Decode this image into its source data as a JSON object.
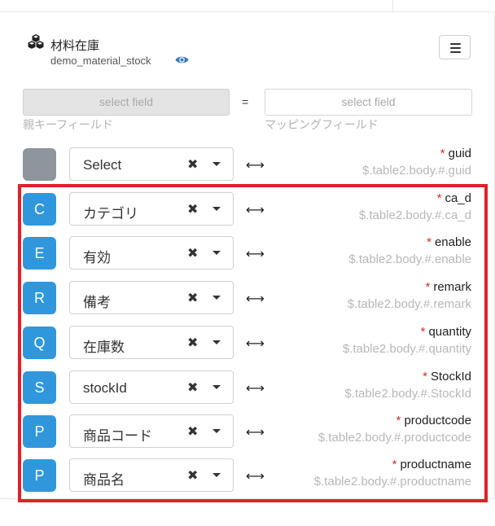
{
  "header": {
    "title": "材料在庫",
    "subtitle": "demo_material_stock"
  },
  "mapping": {
    "left_placeholder": "select field",
    "right_placeholder": "select field",
    "equals": "=",
    "left_label": "親キーフィールド",
    "right_label": "マッピングフィールド",
    "arrow_symbol": "⟷",
    "clear_symbol": "✖",
    "required_mark": "*"
  },
  "rows": [
    {
      "badge": "",
      "badge_color": "#8e959c",
      "value": "Select",
      "name": "guid",
      "path": "$.table2.body.#.guid"
    },
    {
      "badge": "C",
      "badge_color": "#3097dc",
      "value": "カテゴリ",
      "name": "ca_d",
      "path": "$.table2.body.#.ca_d"
    },
    {
      "badge": "E",
      "badge_color": "#3097dc",
      "value": "有効",
      "name": "enable",
      "path": "$.table2.body.#.enable"
    },
    {
      "badge": "R",
      "badge_color": "#3097dc",
      "value": "備考",
      "name": "remark",
      "path": "$.table2.body.#.remark"
    },
    {
      "badge": "Q",
      "badge_color": "#3097dc",
      "value": "在庫数",
      "name": "quantity",
      "path": "$.table2.body.#.quantity"
    },
    {
      "badge": "S",
      "badge_color": "#3097dc",
      "value": "stockId",
      "name": "StockId",
      "path": "$.table2.body.#.StockId"
    },
    {
      "badge": "P",
      "badge_color": "#3097dc",
      "value": "商品コード",
      "name": "productcode",
      "path": "$.table2.body.#.productcode"
    },
    {
      "badge": "P",
      "badge_color": "#3097dc",
      "value": "商品名",
      "name": "productname",
      "path": "$.table2.body.#.productname"
    }
  ],
  "colors": {
    "highlight_border": "#e0212b",
    "badge_blue": "#3097dc",
    "badge_gray": "#8e959c",
    "required": "#d62b2b"
  },
  "icons": {
    "logo": "cubes-icon",
    "visibility": "eye-icon",
    "menu": "hamburger-menu-icon"
  }
}
